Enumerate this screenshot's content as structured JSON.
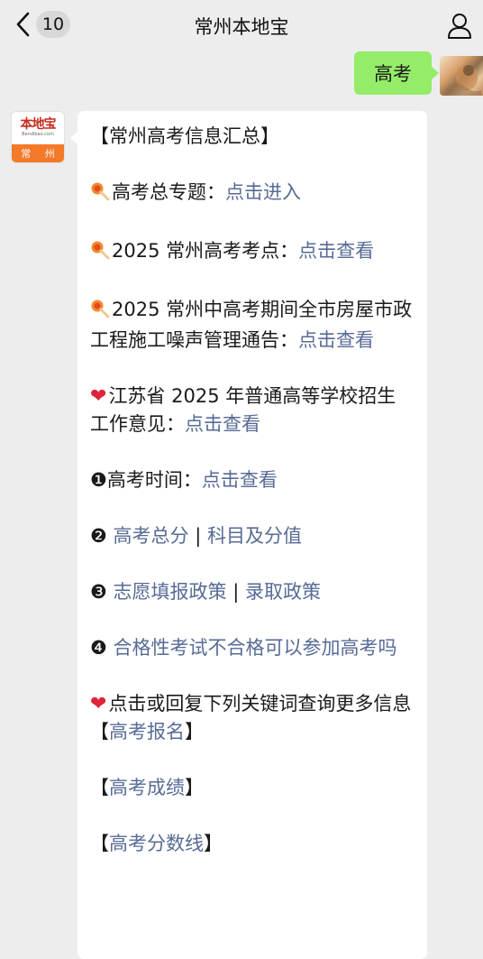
{
  "header": {
    "title": "常州本地宝",
    "unread_count": "10",
    "back_icon": "chevron-left-icon",
    "profile_icon": "person-icon"
  },
  "outgoing": {
    "text": "高考"
  },
  "avatar": {
    "name": "本地宝",
    "url": "Bendibao.com",
    "city": "常 州"
  },
  "message": {
    "title": "【常州高考信息汇总】",
    "item1_text": "高考总专题：",
    "item1_link": "点击进入",
    "item2_text": "2025 常州高考考点：",
    "item2_link": "点击查看",
    "item3_text": "2025 常州中高考期间全市房屋市政工程施工噪声管理通告：",
    "item3_link": "点击查看",
    "item4_text": "江苏省 2025 年普通高等学校招生工作意见：",
    "item4_link": "点击查看",
    "n1": "❶",
    "q1_text": "高考时间：",
    "q1_link": "点击查看",
    "n2": "❷",
    "q2_link_a": "高考总分",
    "q2_sep": " | ",
    "q2_link_b": "科目及分值",
    "n3": "❸",
    "q3_link_a": "志愿填报政策",
    "q3_sep": " | ",
    "q3_link_b": "录取政策",
    "n4": "❹",
    "q4_link": "合格性考试不合格可以参加高考吗",
    "kw_intro": "点击或回复下列关键词查询更多信息",
    "kw1_l": "【",
    "kw1": "高考报名",
    "kw1_r": "】",
    "kw2_l": "【",
    "kw2": "高考成绩",
    "kw2_r": "】",
    "kw3_l": "【",
    "kw3": "高考分数线",
    "kw3_r": "】"
  },
  "colors": {
    "link": "#576b95",
    "out_bubble": "#95ec69",
    "heart": "#e0243a"
  }
}
